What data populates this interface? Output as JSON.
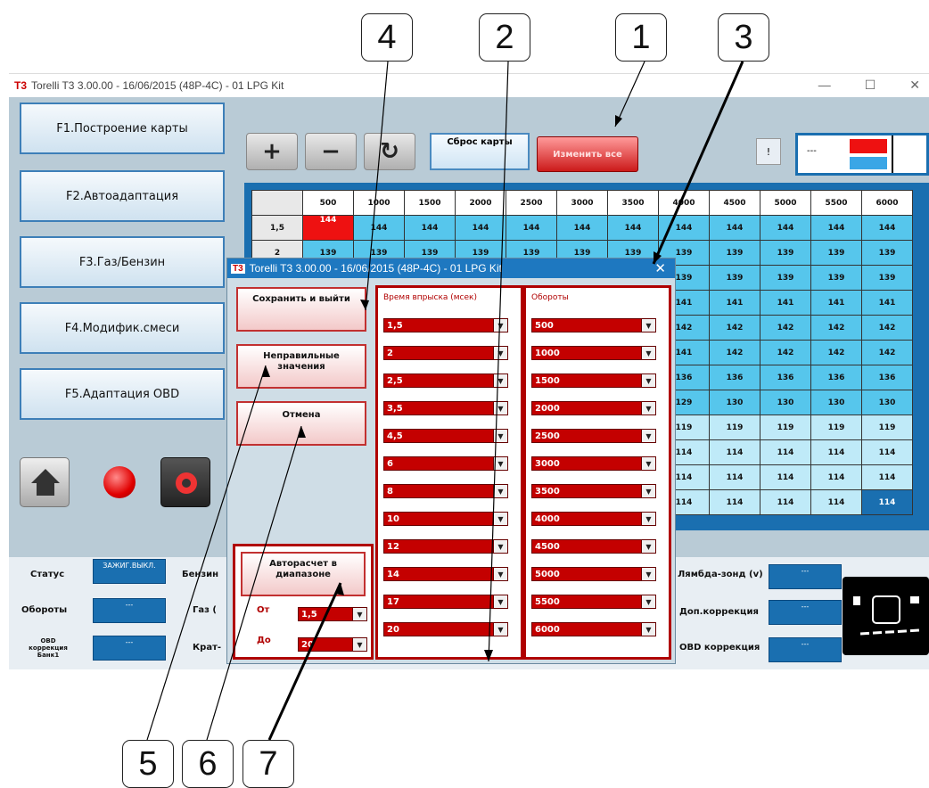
{
  "callouts": [
    "4",
    "2",
    "1",
    "3",
    "5",
    "6",
    "7"
  ],
  "window": {
    "logo": "T3",
    "title": "Torelli T3 3.00.00 - 16/06/2015 (48P-4C) - 01 LPG Kit",
    "minimize": "—",
    "maximize": "☐",
    "close": "✕"
  },
  "sidebar": {
    "items": [
      {
        "label": "F1.Построение карты"
      },
      {
        "label": "F2.Автоадаптация"
      },
      {
        "label": "F3.Газ/Бензин"
      },
      {
        "label": "F4.Модифик.смеси"
      },
      {
        "label": "F5.Адаптация OBD"
      }
    ]
  },
  "toolbar": {
    "plus": "+",
    "minus": "−",
    "refresh": "↻",
    "reset_map": "Сброс карты",
    "change_all": "Изменить все",
    "info": "!",
    "indicator_text": "---"
  },
  "map": {
    "rpm": [
      "500",
      "1000",
      "1500",
      "2000",
      "2500",
      "3000",
      "3500",
      "4000",
      "4500",
      "5000",
      "5500",
      "6000"
    ],
    "rows": [
      {
        "t": "1,5",
        "v": [
          "144",
          "144",
          "144",
          "144",
          "144",
          "144",
          "144",
          "144",
          "144",
          "144",
          "144",
          "144"
        ]
      },
      {
        "t": "2",
        "v": [
          "139",
          "139",
          "139",
          "139",
          "139",
          "139",
          "139",
          "139",
          "139",
          "139",
          "139",
          "139"
        ]
      },
      {
        "t": "2,5",
        "v": [
          "139",
          "139",
          "139",
          "139",
          "139",
          "139",
          "139",
          "139",
          "139",
          "139",
          "139",
          "139"
        ]
      },
      {
        "t": "",
        "v": [
          "",
          "",
          "",
          "",
          "",
          "",
          "",
          "141",
          "141",
          "141",
          "141",
          "141"
        ]
      },
      {
        "t": "",
        "v": [
          "",
          "",
          "",
          "",
          "",
          "",
          "",
          "142",
          "142",
          "142",
          "142",
          "142"
        ]
      },
      {
        "t": "",
        "v": [
          "",
          "",
          "",
          "",
          "",
          "",
          "",
          "141",
          "142",
          "142",
          "142",
          "142"
        ]
      },
      {
        "t": "",
        "v": [
          "",
          "",
          "",
          "",
          "",
          "",
          "",
          "136",
          "136",
          "136",
          "136",
          "136"
        ]
      },
      {
        "t": "",
        "v": [
          "",
          "",
          "",
          "",
          "",
          "",
          "",
          "129",
          "130",
          "130",
          "130",
          "130"
        ]
      },
      {
        "t": "",
        "v": [
          "",
          "",
          "",
          "",
          "",
          "",
          "",
          "119",
          "119",
          "119",
          "119",
          "119"
        ]
      },
      {
        "t": "",
        "v": [
          "",
          "",
          "",
          "",
          "",
          "",
          "",
          "114",
          "114",
          "114",
          "114",
          "114"
        ]
      },
      {
        "t": "",
        "v": [
          "",
          "",
          "",
          "",
          "",
          "",
          "",
          "114",
          "114",
          "114",
          "114",
          "114"
        ]
      },
      {
        "t": "",
        "v": [
          "",
          "",
          "",
          "",
          "",
          "",
          "",
          "114",
          "114",
          "114",
          "114",
          "114"
        ]
      }
    ]
  },
  "status_panel": {
    "status_label": "Статус",
    "status_value": "ЗАЖИГ.ВЫКЛ.",
    "rpm_label": "Обороты",
    "rpm_value": "---",
    "obd_label": "OBD коррекция Банк1",
    "obd_value": "---",
    "petrol_label": "Бензин",
    "gas_label": "Газ (",
    "krat_label": "Крат-",
    "lambda_label": "Лямбда-зонд (v)",
    "lambda_value": "---",
    "addcorr_label": "Доп.коррекция",
    "addcorr_value": "---",
    "obdcorr_label": "OBD коррекция",
    "obdcorr_value": "---"
  },
  "dialog": {
    "title": "Torelli T3 3.00.00 - 16/06/2015 (48P-4C) - 01 LPG Kit",
    "close": "✕",
    "save_exit": "Сохранить и выйти",
    "wrong_values": "Неправильные значения",
    "cancel": "Отмена",
    "auto_calc": "Авторасчет в диапазоне",
    "from_label": "От",
    "from_value": "1,5",
    "to_label": "До",
    "to_value": "20",
    "inj_header": "Время впрыска (мсек)",
    "rpm_header": "Обороты",
    "inj_values": [
      "1,5",
      "2",
      "2,5",
      "3,5",
      "4,5",
      "6",
      "8",
      "10",
      "12",
      "14",
      "17",
      "20"
    ],
    "rpm_values": [
      "500",
      "1000",
      "1500",
      "2000",
      "2500",
      "3000",
      "3500",
      "4000",
      "4500",
      "5000",
      "5500",
      "6000"
    ]
  }
}
